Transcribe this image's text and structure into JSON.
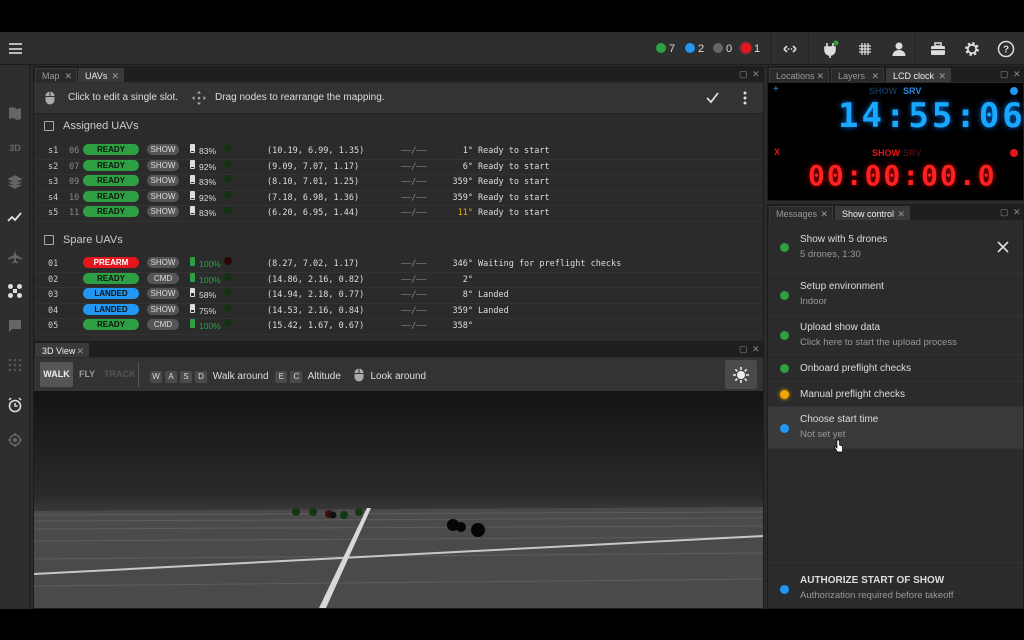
{
  "status": {
    "green_count": "7",
    "blue_count": "2",
    "gray_count": "0",
    "red_count": "1"
  },
  "uavs_panel": {
    "tabs": [
      "Map",
      "UAVs"
    ],
    "hint1": "Click to edit a single slot.",
    "hint2": "Drag nodes to rearrange the mapping.",
    "assigned_title": "Assigned UAVs",
    "spare_title": "Spare UAVs",
    "assigned": [
      {
        "slot": "s1",
        "id": "06",
        "status": "READY",
        "mode": "SHOW",
        "battery": "83%",
        "battery_level": 0.83,
        "pos": "(10.19, 6.99, 1.35)",
        "gps": "——/——",
        "heading": "1°",
        "msg": "Ready to start"
      },
      {
        "slot": "s2",
        "id": "07",
        "status": "READY",
        "mode": "SHOW",
        "battery": "92%",
        "battery_level": 0.92,
        "pos": "(9.09, 7.07, 1.17)",
        "gps": "——/——",
        "heading": "6°",
        "msg": "Ready to start"
      },
      {
        "slot": "s3",
        "id": "09",
        "status": "READY",
        "mode": "SHOW",
        "battery": "83%",
        "battery_level": 0.83,
        "pos": "(8.10, 7.01, 1.25)",
        "gps": "——/——",
        "heading": "359°",
        "msg": "Ready to start"
      },
      {
        "slot": "s4",
        "id": "10",
        "status": "READY",
        "mode": "SHOW",
        "battery": "92%",
        "battery_level": 0.92,
        "pos": "(7.18, 6.98, 1.36)",
        "gps": "——/——",
        "heading": "359°",
        "msg": "Ready to start"
      },
      {
        "slot": "s5",
        "id": "11",
        "status": "READY",
        "mode": "SHOW",
        "battery": "83%",
        "battery_level": 0.83,
        "pos": "(6.20, 6.95, 1.44)",
        "gps": "——/——",
        "heading": "11°",
        "msg": "Ready to start",
        "heading_warn": true
      }
    ],
    "spare": [
      {
        "id": "01",
        "status": "PREARM",
        "mode": "SHOW",
        "battery": "100%",
        "battery_level": 1.0,
        "pos": "(8.27, 7.02, 1.17)",
        "gps": "——/——",
        "heading": "346°",
        "msg": "Waiting for preflight checks"
      },
      {
        "id": "02",
        "status": "READY",
        "mode": "CMD",
        "battery": "100%",
        "battery_level": 1.0,
        "pos": "(14.86, 2.16, 0.82)",
        "gps": "——/——",
        "heading": "2°",
        "msg": ""
      },
      {
        "id": "03",
        "status": "LANDED",
        "mode": "SHOW",
        "battery": "58%",
        "battery_level": 0.58,
        "pos": "(14.94, 2.18, 0.77)",
        "gps": "——/——",
        "heading": "8°",
        "msg": "Landed"
      },
      {
        "id": "04",
        "status": "LANDED",
        "mode": "SHOW",
        "battery": "75%",
        "battery_level": 0.75,
        "pos": "(14.53, 2.16, 0.84)",
        "gps": "——/——",
        "heading": "359°",
        "msg": "Landed"
      },
      {
        "id": "05",
        "status": "READY",
        "mode": "CMD",
        "battery": "100%",
        "battery_level": 1.0,
        "pos": "(15.42, 1.67, 0.67)",
        "gps": "——/——",
        "heading": "358°",
        "msg": ""
      }
    ]
  },
  "view3d": {
    "tab": "3D View",
    "modes": [
      "WALK",
      "FLY",
      "TRACK"
    ],
    "keys_walk": [
      "W",
      "A",
      "S",
      "D"
    ],
    "walk_label": "Walk around",
    "keys_alt": [
      "E",
      "C"
    ],
    "alt_label": "Altitude",
    "look_label": "Look around"
  },
  "right_top": {
    "tabs": [
      "Locations",
      "Layers",
      "LCD clock"
    ],
    "show_label": "SHOW",
    "srv_label": "SRV",
    "clock_time": "14:55:06",
    "show_timer": "00:00:00.0",
    "marker_plus": "+",
    "marker_x": "X"
  },
  "right_bottom": {
    "tabs": [
      "Messages",
      "Show control"
    ],
    "steps": [
      {
        "title": "Show with 5 drones",
        "sub": "5 drones, 1:30",
        "color": "#2ea043"
      },
      {
        "title": "Setup environment",
        "sub": "Indoor",
        "color": "#2ea043"
      },
      {
        "title": "Upload show data",
        "sub": "Click here to start the upload process",
        "color": "#2ea043"
      },
      {
        "title": "Onboard preflight checks",
        "sub": "",
        "color": "#2ea043"
      },
      {
        "title": "Manual preflight checks",
        "sub": "",
        "color": "#f0a500"
      },
      {
        "title": "Choose start time",
        "sub": "Not set yet",
        "color": "#2196f3"
      }
    ],
    "authorize_title": "AUTHORIZE START OF SHOW",
    "authorize_sub": "Authorization required before takeoff",
    "authorize_color": "#2196f3"
  }
}
